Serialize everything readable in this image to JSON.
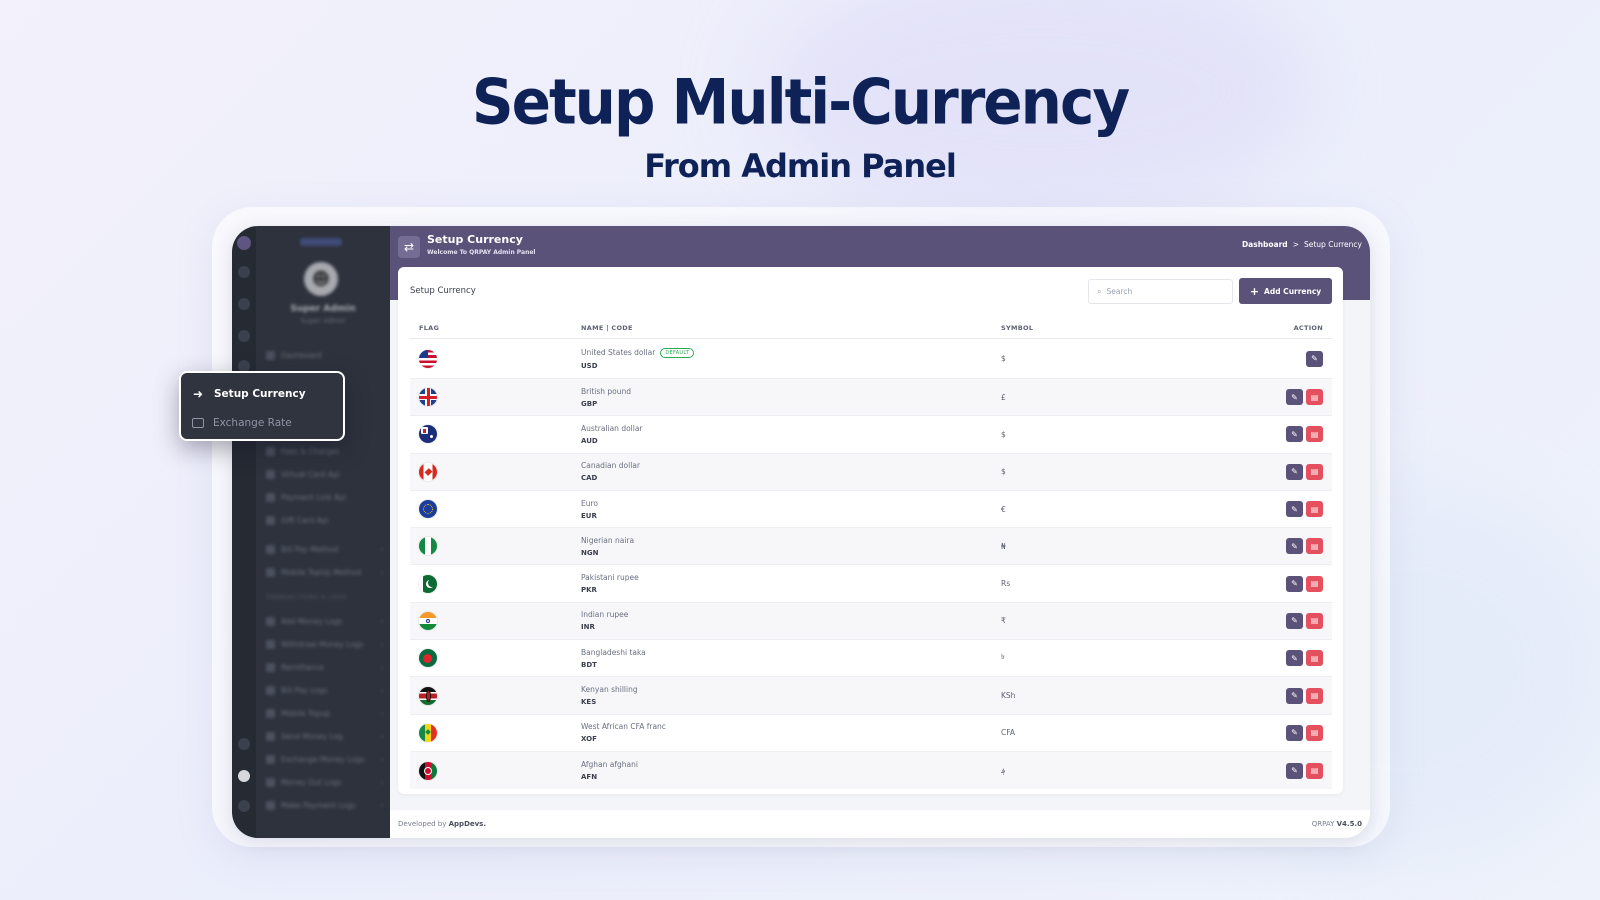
{
  "hero": {
    "title": "Setup Multi-Currency",
    "subtitle": "From Admin Panel"
  },
  "sidebar": {
    "user_name": "Super Admin",
    "user_role": "Super Admin",
    "items": [
      {
        "label": "Dashboard"
      },
      {
        "label": "Fees & Charges"
      },
      {
        "label": "Virtual Card Api"
      },
      {
        "label": "Payment Link Api"
      },
      {
        "label": "Gift Card Api"
      },
      {
        "label": "Bill Pay Method"
      },
      {
        "label": "Mobile TopUp Method"
      },
      {
        "label": "Add Money Logs"
      },
      {
        "label": "Withdraw Money Logs"
      },
      {
        "label": "Remittance"
      },
      {
        "label": "Bill Pay Logs"
      },
      {
        "label": "Mobile Topup"
      },
      {
        "label": "Send Money Log"
      },
      {
        "label": "Exchange Money Logs"
      },
      {
        "label": "Money Out Logs"
      },
      {
        "label": "Make Payment Logs"
      }
    ],
    "section_transactions": "TRANSACTIONS & LOGS"
  },
  "popup": {
    "active": "Setup Currency",
    "other": "Exchange Rate"
  },
  "topbar": {
    "title": "Setup Currency",
    "subtitle": "Welcome To QRPAY Admin Panel",
    "crumb_home": "Dashboard",
    "crumb_sep": ">",
    "crumb_current": "Setup Currency"
  },
  "card": {
    "title": "Setup Currency",
    "search_placeholder": "Search",
    "add_label": "Add Currency"
  },
  "table": {
    "headers": {
      "flag": "FLAG",
      "name": "NAME | CODE",
      "symbol": "SYMBOL",
      "action": "ACTION"
    },
    "default_badge": "DEFAULT",
    "rows": [
      {
        "name": "United States dollar",
        "code": "USD",
        "symbol": "$",
        "flag": "us"
      },
      {
        "name": "British pound",
        "code": "GBP",
        "symbol": "£",
        "flag": "gb"
      },
      {
        "name": "Australian dollar",
        "code": "AUD",
        "symbol": "$",
        "flag": "au"
      },
      {
        "name": "Canadian dollar",
        "code": "CAD",
        "symbol": "$",
        "flag": "ca"
      },
      {
        "name": "Euro",
        "code": "EUR",
        "symbol": "€",
        "flag": "eu"
      },
      {
        "name": "Nigerian naira",
        "code": "NGN",
        "symbol": "₦",
        "flag": "ng"
      },
      {
        "name": "Pakistani rupee",
        "code": "PKR",
        "symbol": "Rs",
        "flag": "pk"
      },
      {
        "name": "Indian rupee",
        "code": "INR",
        "symbol": "₹",
        "flag": "in"
      },
      {
        "name": "Bangladeshi taka",
        "code": "BDT",
        "symbol": "৳",
        "flag": "bd"
      },
      {
        "name": "Kenyan shilling",
        "code": "KES",
        "symbol": "KSh",
        "flag": "ke"
      },
      {
        "name": "West African CFA franc",
        "code": "XOF",
        "symbol": "CFA",
        "flag": "sn"
      },
      {
        "name": "Afghan afghani",
        "code": "AFN",
        "symbol": "؋",
        "flag": "af"
      }
    ]
  },
  "footer": {
    "developed_by": "Developed by",
    "brand": "AppDevs.",
    "app": "QRPAY",
    "version": "V4.5.0"
  },
  "colors": {
    "primary": "#5b527a",
    "danger": "#e5505f",
    "hero_text": "#0f2258",
    "sidebar_bg": "#2d323c"
  }
}
